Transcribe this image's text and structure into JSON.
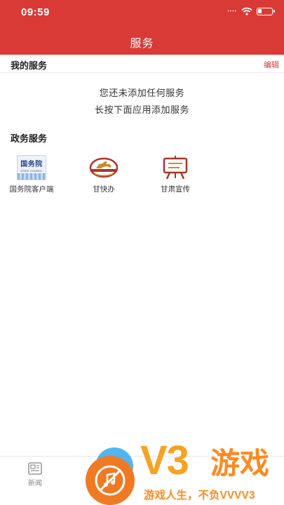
{
  "status_bar": {
    "time": "09:59",
    "signal_dots": "••••"
  },
  "header": {
    "title": "服务"
  },
  "my_services": {
    "title": "我的服务",
    "edit_label": "编辑",
    "empty_line1": "您还未添加任何服务",
    "empty_line2": "长按下面应用添加服务"
  },
  "gov_services": {
    "title": "政务服务",
    "apps": [
      {
        "label": "国务院客户端",
        "icon": "state-council-icon",
        "icon_text": "国务院",
        "icon_subtext": "STATE COUNCIL"
      },
      {
        "label": "甘快办",
        "icon": "horse-emblem-icon"
      },
      {
        "label": "甘肃宣传",
        "icon": "easel-icon"
      }
    ]
  },
  "bottom_nav": {
    "news_label": "新闻"
  },
  "watermark": {
    "logo_text": "V3",
    "brand": "游戏",
    "slogan": "游戏人生，不负VVVV3"
  },
  "colors": {
    "brand_red": "#d93a36",
    "watermark_orange": "#f5a323",
    "watermark_blue": "#33a8f0"
  }
}
